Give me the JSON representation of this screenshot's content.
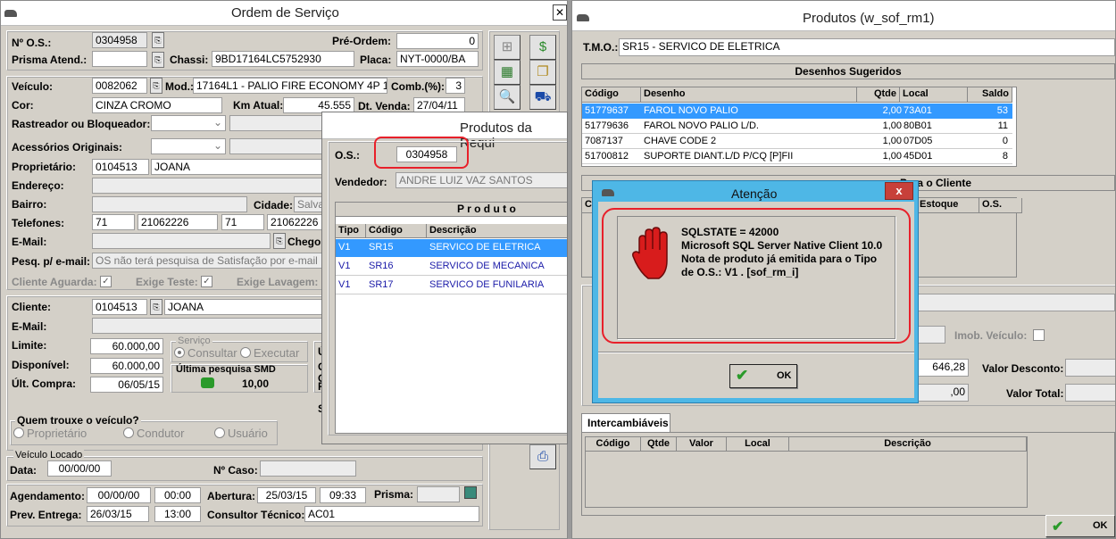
{
  "os_window": {
    "title": "Ordem de Serviço",
    "close": "✕",
    "header": {
      "os_label": "Nº O.S.:",
      "os_value": "0304958",
      "preordem_label": "Pré-Ordem:",
      "preordem_value": "0",
      "prisma_label": "Prisma Atend.:",
      "prisma_value": "",
      "chassi_label": "Chassi:",
      "chassi_value": "9BD17164LC5752930",
      "placa_label": "Placa:",
      "placa_value": "NYT-0000/BA"
    },
    "veiculo": {
      "veiculo_label": "Veículo:",
      "veiculo_code": "0082062",
      "mod_label": "Mod.:",
      "mod_value": "17164L1 - PALIO FIRE ECONOMY 4P 1",
      "comb_label": "Comb.(%):",
      "comb_value": "3",
      "cor_label": "Cor:",
      "cor_value": "CINZA CROMO",
      "km_label": "Km Atual:",
      "km_value": "45.555",
      "dtvenda_label": "Dt. Venda:",
      "dtvenda_value": "27/04/11",
      "rastreador_label": "Rastreador ou Bloqueador:",
      "acessorios_label": "Acessórios Originais:",
      "proprietario_label": "Proprietário:",
      "proprietario_code": "0104513",
      "proprietario_name": "JOANA",
      "endereco_label": "Endereço:",
      "bairro_label": "Bairro:",
      "cidade_label": "Cidade:",
      "cidade_value": "Salva",
      "telefones_label": "Telefones:",
      "tel1_ddd": "71",
      "tel1": "21062226",
      "tel2_ddd": "71",
      "tel2": "21062226",
      "email_label": "E-Mail:",
      "chegou_label": "Chegou",
      "pesq_label": "Pesq. p/ e-mail:",
      "pesq_value": "OS não terá pesquisa de Satisfação por e-mail",
      "cliente_aguarda_label": "Cliente Aguarda:",
      "exige_teste_label": "Exige Teste:",
      "exige_lavagem_label": "Exige Lavagem:",
      "check_mark": "✓"
    },
    "cliente": {
      "cliente_label": "Cliente:",
      "cliente_code": "0104513",
      "cliente_name": "JOANA",
      "email_label": "E-Mail:",
      "limite_label": "Limite:",
      "limite_value": "60.000,00",
      "disponivel_label": "Disponível:",
      "disponivel_value": "60.000,00",
      "ult_compra_label": "Últ. Compra:",
      "ult_compra_value": "06/05/15",
      "servico_group": "Serviço",
      "consultar": "Consultar",
      "executar": "Executar",
      "ultima_pesquisa": "Última pesquisa SMD",
      "pesquisa_value": "10,00",
      "side_letters": [
        "Ú",
        "C",
        "C",
        "R",
        "S"
      ]
    },
    "quem_trouxe": {
      "title": "Quem trouxe o veículo?",
      "proprietario": "Proprietário",
      "condutor": "Condutor",
      "usuario": "Usuário"
    },
    "veiculo_locado": {
      "title": "Veículo Locado",
      "data_label": "Data:",
      "data_value": "00/00/00",
      "caso_label": "Nº Caso:"
    },
    "footer": {
      "agendamento_label": "Agendamento:",
      "agendamento_date": "00/00/00",
      "agendamento_time": "00:00",
      "abertura_label": "Abertura:",
      "abertura_date": "25/03/15",
      "abertura_time": "09:33",
      "prisma_label": "Prisma:",
      "prev_label": "Prev. Entrega:",
      "prev_date": "26/03/15",
      "prev_time": "13:00",
      "consultor_label": "Consultor Técnico:",
      "consultor_value": "AC01"
    },
    "toolbar_icons": [
      "grid-icon",
      "money-icon",
      "spreadsheet-icon",
      "documents-icon",
      "magnifier-document-icon",
      "car-icon"
    ]
  },
  "requisicao_window": {
    "title": "Produtos da Requi",
    "os_label": "O.S.:",
    "os_value": "0304958",
    "vendedor_label": "Vendedor:",
    "vendedor_value": "ANDRE LUIZ VAZ SANTOS",
    "table_title": "P r o d u t o",
    "columns": [
      "Tipo",
      "Código",
      "Descrição"
    ],
    "rows": [
      [
        "V1",
        "SR15",
        "SERVICO DE ELETRICA"
      ],
      [
        "V1",
        "SR16",
        "SERVICO DE MECANICA"
      ],
      [
        "V1",
        "SR17",
        "SERVICO DE FUNILARIA"
      ]
    ]
  },
  "produtos_window": {
    "title": "Produtos (w_sof_rm1)",
    "tmo_label": "T.M.O.:",
    "tmo_value": "SR15 - SERVICO DE ELETRICA",
    "desenhos_title": "Desenhos Sugeridos",
    "desenhos_columns": [
      "Código",
      "Desenho",
      "Qtde",
      "Local",
      "Saldo"
    ],
    "desenhos_rows": [
      [
        "51779637",
        "FAROL  NOVO PALIO",
        "2,00",
        "73A01",
        "53"
      ],
      [
        "51779636",
        "FAROL NOVO PALIO  L/D.",
        "1,00",
        "80B01",
        "11"
      ],
      [
        "7087137",
        "CHAVE CODE 2",
        "1,00",
        "07D05",
        "0"
      ],
      [
        "51700812",
        "SUPORTE DIANT.L/D P/CQ [P]FII",
        "1,00",
        "45D01",
        "8"
      ]
    ],
    "second_title": "Para o Cliente",
    "second_columns": [
      "Co",
      "Estoque",
      "O.S."
    ],
    "imob_label": "Imob. Veículo:",
    "valor_value": "646,28",
    "valor_desconto_label": "Valor Desconto:",
    "total_value": ",00",
    "valor_total_label": "Valor Total:",
    "tab_label": "Intercambiáveis",
    "inter_columns": [
      "Código",
      "Qtde",
      "Valor",
      "Local",
      "Descrição"
    ],
    "ok_label": "OK"
  },
  "dialog": {
    "title": "Atenção",
    "close": "x",
    "message_lines": [
      "SQLSTATE = 42000",
      "Microsoft SQL Server Native Client 10.0",
      "Nota de produto já emitida para o Tipo",
      "de O.S.: V1 . [sof_rm_i]"
    ],
    "ok_label": "OK"
  },
  "colors": {
    "selection": "#3399ff",
    "annotation_red": "#e8202a",
    "dialog_title": "#4eb7e6",
    "link_blue": "#1a1aa8"
  }
}
